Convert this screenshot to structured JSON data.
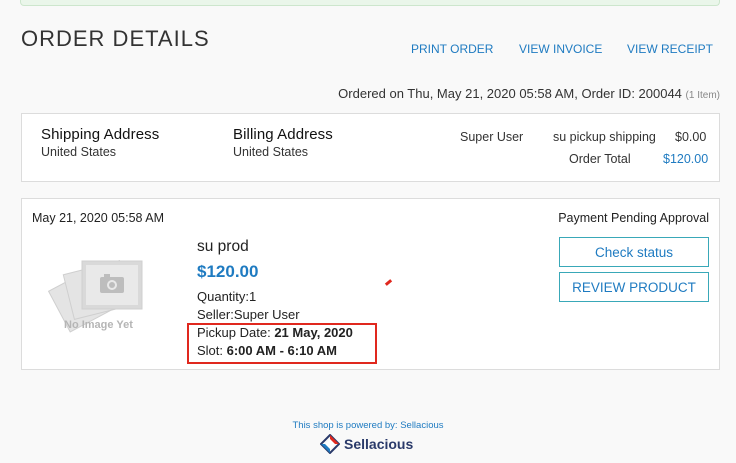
{
  "page": {
    "title": "ORDER DETAILS"
  },
  "actions": {
    "print": "PRINT ORDER",
    "invoice": "VIEW INVOICE",
    "receipt": "VIEW RECEIPT"
  },
  "order": {
    "meta": "Ordered on Thu, May 21, 2020 05:58 AM, Order ID: 200044",
    "items_count": "(1 Item)"
  },
  "addresses": {
    "shipping_heading": "Shipping Address",
    "shipping_country": "United States",
    "billing_heading": "Billing Address",
    "billing_country": "United States"
  },
  "summary": {
    "customer": "Super User",
    "shipping_label": "su pickup shipping",
    "shipping_value": "$0.00",
    "total_label": "Order Total",
    "total_value": "$120.00"
  },
  "item": {
    "date": "May 21, 2020 05:58 AM",
    "status": "Payment Pending Approval",
    "no_image_text": "No Image Yet",
    "name": "su prod",
    "price": "$120.00",
    "quantity_line": "Quantity:1",
    "seller_line": "Seller:Super User",
    "pickup_label": "Pickup Date: ",
    "pickup_value": "21 May, 2020",
    "slot_label": "Slot: ",
    "slot_value": "6:00 AM - 6:10 AM",
    "check_status_label": "Check status",
    "review_label": "REVIEW PRODUCT"
  },
  "footer": {
    "powered_by": "This shop is powered by: Sellacious",
    "logo_text": "Sellacious"
  },
  "colors": {
    "accent": "#1f7bc1",
    "highlight": "#e0281e",
    "button_border": "#39a8b8"
  }
}
